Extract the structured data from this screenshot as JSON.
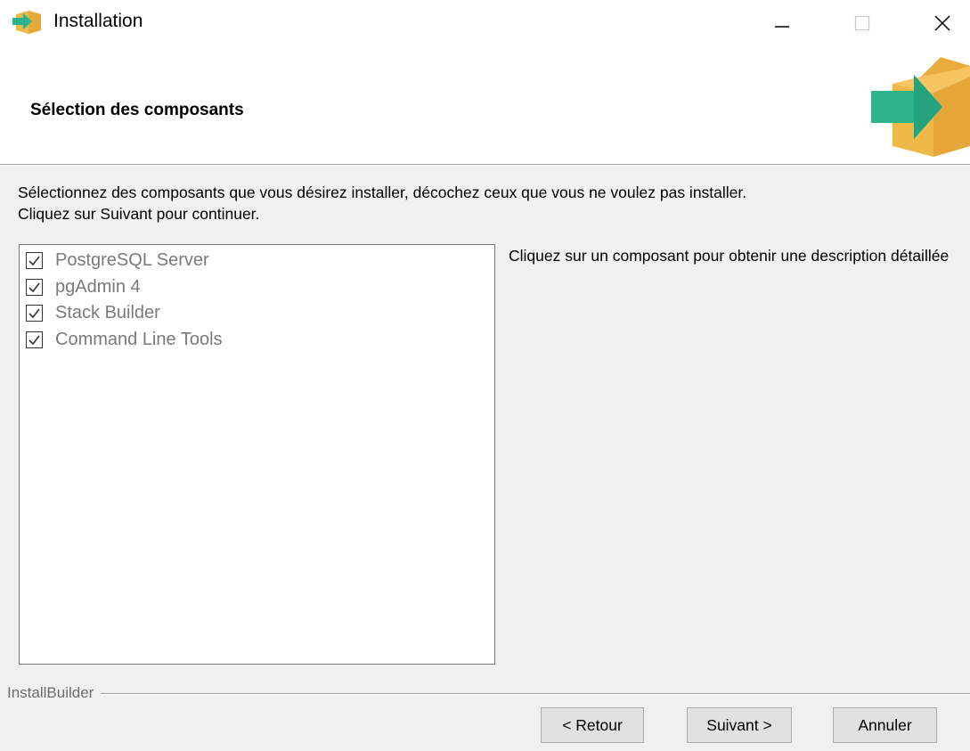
{
  "window": {
    "title": "Installation",
    "controls": {
      "minimize": "minimize-icon",
      "maximize": "maximize-icon",
      "close": "close-icon"
    }
  },
  "header": {
    "title": "Sélection des composants",
    "logo_icon": "install-box-arrow-icon"
  },
  "instructions": {
    "line1": "Sélectionnez des composants que vous désirez installer, décochez ceux que vous ne voulez pas installer.",
    "line2": "Cliquez sur Suivant pour continuer."
  },
  "components": [
    {
      "label": "PostgreSQL Server",
      "checked": true
    },
    {
      "label": "pgAdmin 4",
      "checked": true
    },
    {
      "label": "Stack Builder",
      "checked": true
    },
    {
      "label": "Command Line Tools",
      "checked": true
    }
  ],
  "description": {
    "text": "Cliquez sur un composant pour obtenir une description détaillée"
  },
  "footer": {
    "brand": "InstallBuilder",
    "back_label": "< Retour",
    "next_label": "Suivant >",
    "cancel_label": "Annuler"
  },
  "colors": {
    "box_orange": "#f0b849",
    "arrow_green": "#2db38a",
    "disabled_text": "#7a7a7a"
  }
}
